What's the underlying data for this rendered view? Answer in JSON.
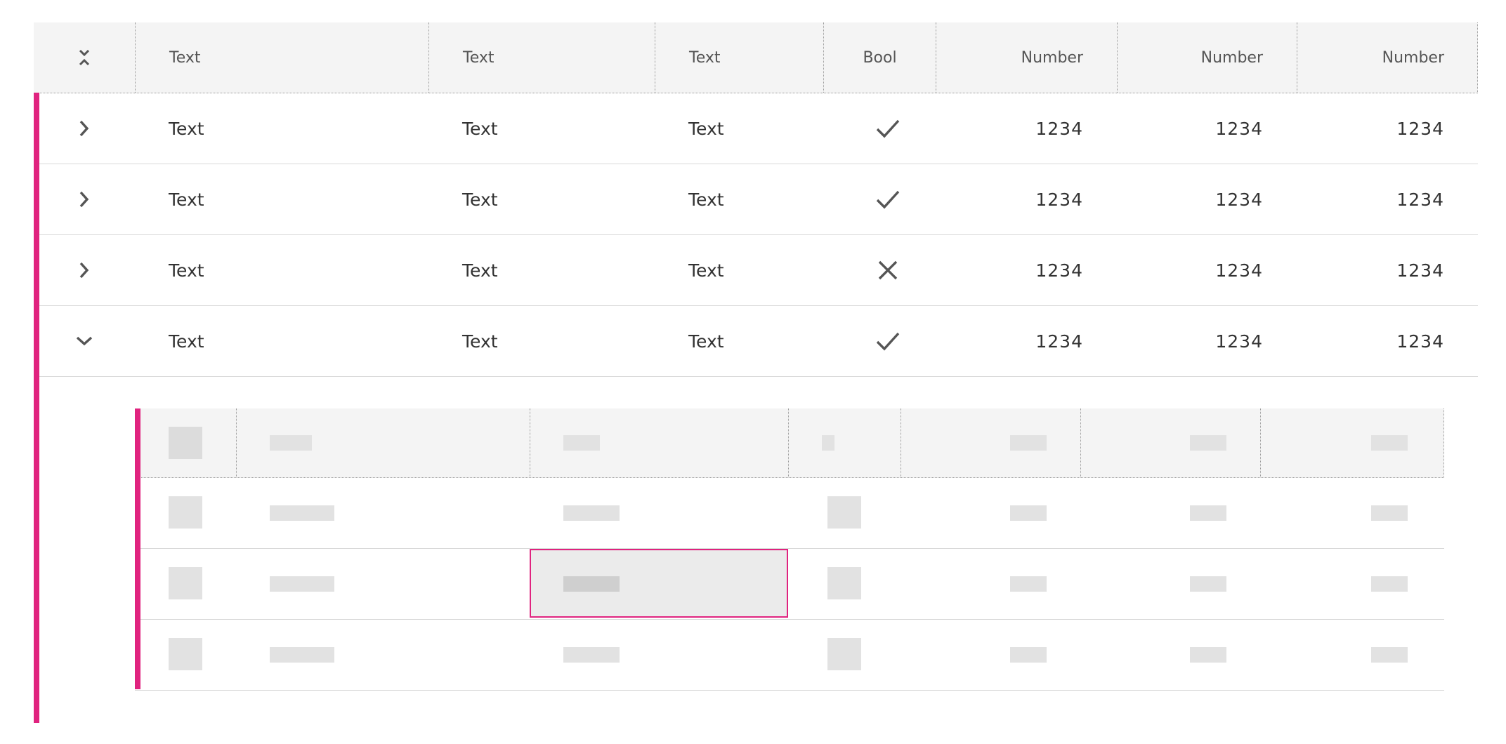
{
  "columns": {
    "c1": "Text",
    "c2": "Text",
    "c3": "Text",
    "c4": "Bool",
    "c5": "Number",
    "c6": "Number",
    "c7": "Number"
  },
  "rows": [
    {
      "c1": "Text",
      "c2": "Text",
      "c3": "Text",
      "bool": "check-icon",
      "n1": "1234",
      "n2": "1234",
      "n3": "1234",
      "expanded": false
    },
    {
      "c1": "Text",
      "c2": "Text",
      "c3": "Text",
      "bool": "check-icon",
      "n1": "1234",
      "n2": "1234",
      "n3": "1234",
      "expanded": false
    },
    {
      "c1": "Text",
      "c2": "Text",
      "c3": "Text",
      "bool": "close-icon",
      "n1": "1234",
      "n2": "1234",
      "n3": "1234",
      "expanded": false
    },
    {
      "c1": "Text",
      "c2": "Text",
      "c3": "Text",
      "bool": "check-icon",
      "n1": "1234",
      "n2": "1234",
      "n3": "1234",
      "expanded": true
    }
  ],
  "colors": {
    "accent": "#e0237f",
    "header_bg": "#f4f4f4",
    "skeleton": "#e2e2e2"
  }
}
